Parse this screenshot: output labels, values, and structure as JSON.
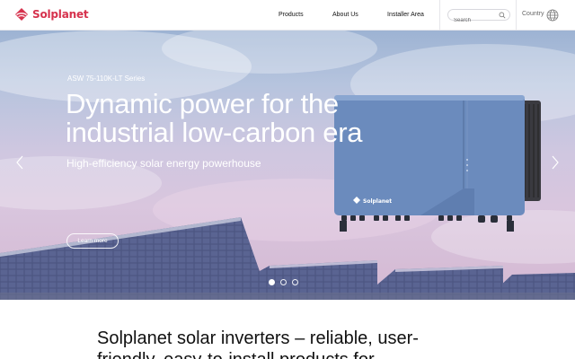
{
  "header": {
    "logo_text": "Solplanet",
    "nav": [
      {
        "label": "Products"
      },
      {
        "label": "About Us"
      },
      {
        "label": "Installer Area"
      }
    ],
    "search": {
      "placeholder": "Search",
      "value": ""
    },
    "country_label": "Country"
  },
  "hero": {
    "series_label": "ASW 75-110K-LT Series",
    "headline": "Dynamic power for the industrial low-carbon era",
    "subhead": "High-efficiency solar energy powerhouse",
    "cta_label": "Learn more",
    "product_brand": "Solplanet",
    "carousel": {
      "slide_count": 3,
      "active_index": 0
    }
  },
  "intro": {
    "text": "Solplanet solar inverters – reliable, user-friendly, easy-to-install products for"
  },
  "colors": {
    "brand": "#d6324d",
    "inverter_blue": "#6b8bbd",
    "text_dark": "#111111"
  }
}
